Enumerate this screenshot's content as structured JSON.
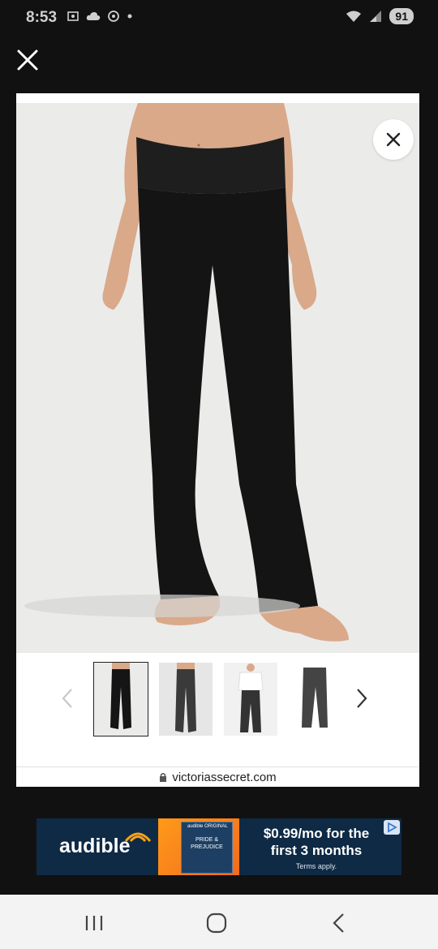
{
  "status_bar": {
    "time": "8:53",
    "battery": "91",
    "left_icons": [
      "screenshot-icon",
      "cloud-icon",
      "sync-icon",
      "dot-icon"
    ],
    "right_icons": [
      "wifi-icon",
      "signal-icon"
    ]
  },
  "viewer": {
    "close_icon": "close-icon",
    "image_close_icon": "close-icon",
    "main_image": "black foldover flare yoga pants on model",
    "thumbnails": [
      {
        "label": "model front view",
        "active": true
      },
      {
        "label": "model front view gray",
        "active": false
      },
      {
        "label": "model with white tee",
        "active": false
      },
      {
        "label": "product flat lay",
        "active": false
      }
    ],
    "prev_icon": "chevron-left-icon",
    "next_icon": "chevron-right-icon",
    "url": "victoriassecret.com"
  },
  "ad": {
    "brand": "audible",
    "book_brand": "audible ORIGINAL",
    "book_title": "PRIDE & PREJUDICE",
    "headline_line1": "$0.99/mo for the",
    "headline_line2": "first 3 months",
    "terms": "Terms apply."
  },
  "nav_bar": {
    "buttons": [
      "recent-apps",
      "home",
      "back"
    ]
  }
}
